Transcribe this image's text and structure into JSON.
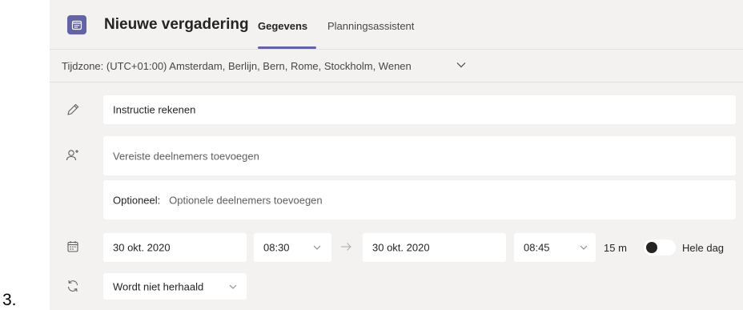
{
  "list_number": "3.",
  "header": {
    "title": "Nieuwe vergadering",
    "tabs": [
      {
        "label": "Gegevens",
        "active": true
      },
      {
        "label": "Planningsassistent",
        "active": false
      }
    ]
  },
  "timezone": {
    "label": "Tijdzone: (UTC+01:00) Amsterdam, Berlijn, Bern, Rome, Stockholm, Wenen"
  },
  "form": {
    "title_value": "Instructie rekenen",
    "required_attendees_placeholder": "Vereiste deelnemers toevoegen",
    "optional_label": "Optioneel:",
    "optional_placeholder": "Optionele deelnemers toevoegen",
    "start_date": "30 okt. 2020",
    "start_time": "08:30",
    "end_date": "30 okt. 2020",
    "end_time": "08:45",
    "duration": "15 m",
    "all_day_label": "Hele dag",
    "all_day_enabled": false,
    "repeat_value": "Wordt niet herhaald"
  },
  "colors": {
    "accent": "#6264a7",
    "background": "#f3f2f1",
    "field": "#ffffff"
  },
  "icons": {
    "app": "calendar-icon",
    "title_row": "pencil-icon",
    "attendees_row": "add-person-icon",
    "datetime_row": "calendar-icon",
    "repeat_row": "repeat-icon"
  }
}
